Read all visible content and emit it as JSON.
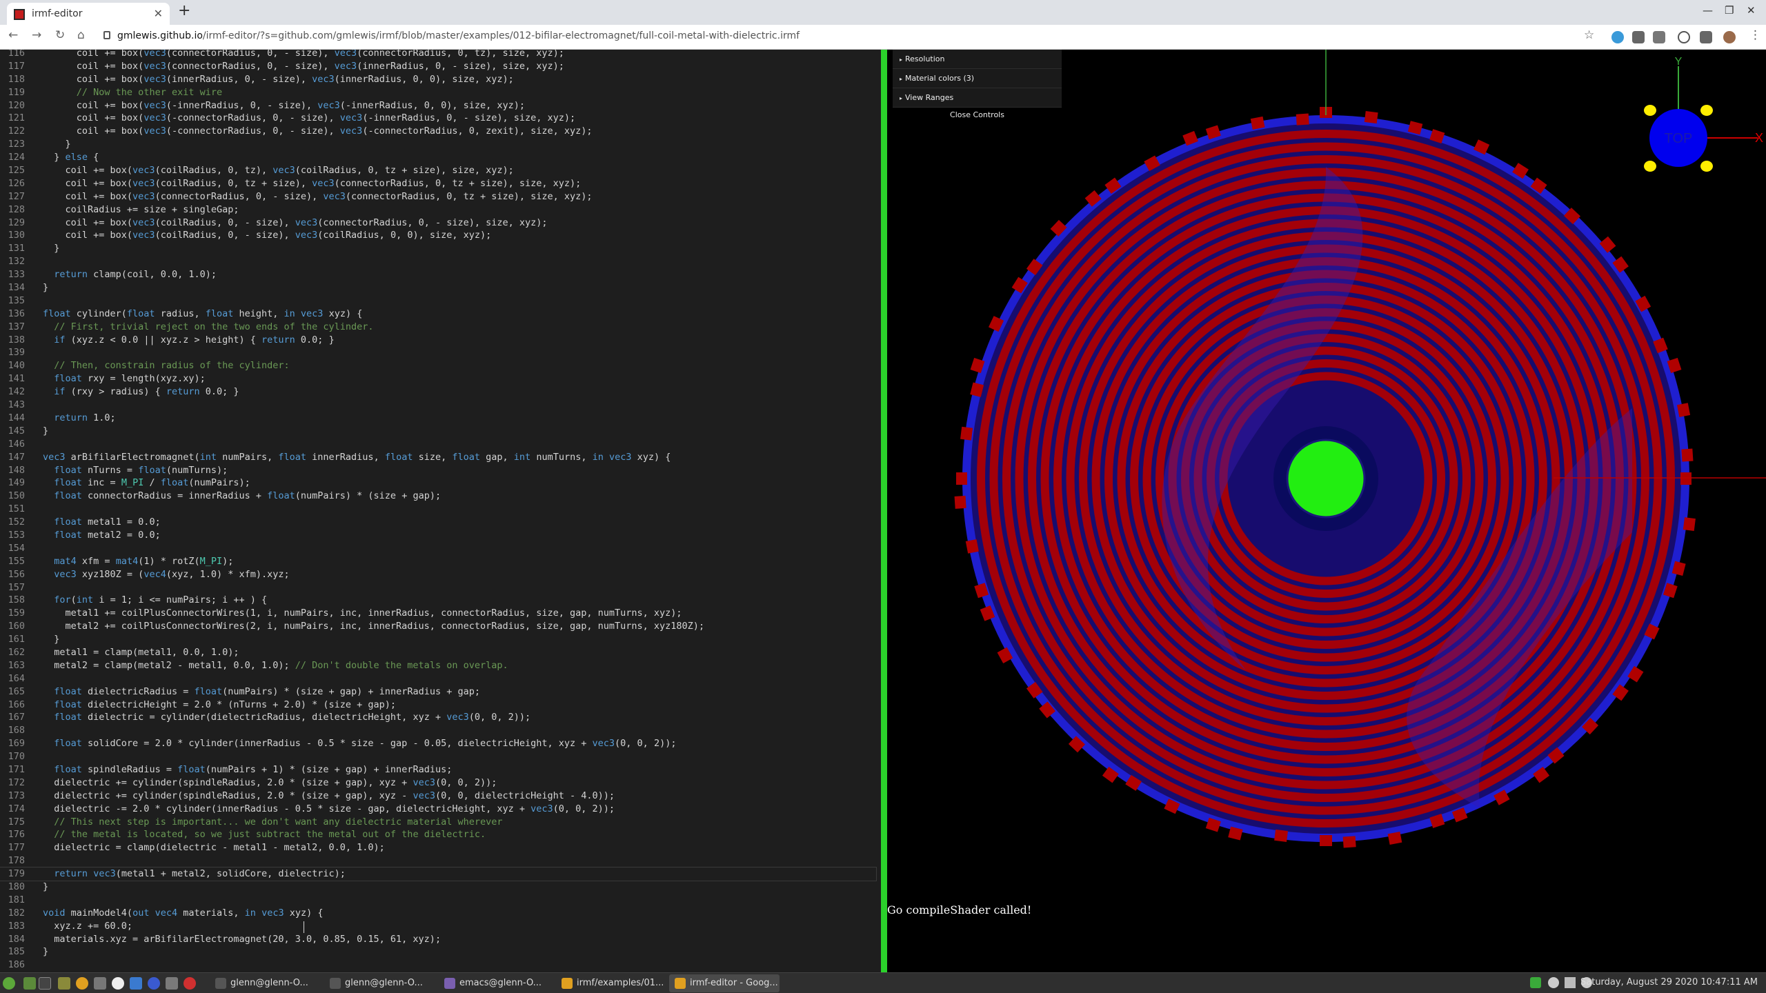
{
  "browser": {
    "tab_title": "irmf-editor",
    "tab_close": "✕",
    "new_tab": "+",
    "win_min": "—",
    "win_max": "❐",
    "win_close": "✕",
    "nav_back": "←",
    "nav_forward": "→",
    "nav_reload": "↻",
    "nav_home": "⌂",
    "url_host": "gmlewis.github.io",
    "url_path": "/irmf-editor/?s=github.com/gmlewis/irmf/blob/master/examples/012-bifilar-electromagnet/full-coil-metal-with-dielectric.irmf",
    "bookmark_star": "☆"
  },
  "editor": {
    "lines": [
      {
        "n": "116",
        "t": "      coil += box(vec3(connectorRadius, 0, - size), vec3(connectorRadius, 0, tz), size, xyz);"
      },
      {
        "n": "117",
        "t": "      coil += box(vec3(connectorRadius, 0, - size), vec3(innerRadius, 0, - size), size, xyz);"
      },
      {
        "n": "118",
        "t": "      coil += box(vec3(innerRadius, 0, - size), vec3(innerRadius, 0, 0), size, xyz);"
      },
      {
        "n": "119",
        "t": "      // Now the other exit wire"
      },
      {
        "n": "120",
        "t": "      coil += box(vec3(-innerRadius, 0, - size), vec3(-innerRadius, 0, 0), size, xyz);"
      },
      {
        "n": "121",
        "t": "      coil += box(vec3(-connectorRadius, 0, - size), vec3(-innerRadius, 0, - size), size, xyz);"
      },
      {
        "n": "122",
        "t": "      coil += box(vec3(-connectorRadius, 0, - size), vec3(-connectorRadius, 0, zexit), size, xyz);"
      },
      {
        "n": "123",
        "t": "    }"
      },
      {
        "n": "124",
        "t": "  } else {"
      },
      {
        "n": "125",
        "t": "    coil += box(vec3(coilRadius, 0, tz), vec3(coilRadius, 0, tz + size), size, xyz);"
      },
      {
        "n": "126",
        "t": "    coil += box(vec3(coilRadius, 0, tz + size), vec3(connectorRadius, 0, tz + size), size, xyz);"
      },
      {
        "n": "127",
        "t": "    coil += box(vec3(connectorRadius, 0, - size), vec3(connectorRadius, 0, tz + size), size, xyz);"
      },
      {
        "n": "128",
        "t": "    coilRadius += size + singleGap;"
      },
      {
        "n": "129",
        "t": "    coil += box(vec3(coilRadius, 0, - size), vec3(connectorRadius, 0, - size), size, xyz);"
      },
      {
        "n": "130",
        "t": "    coil += box(vec3(coilRadius, 0, - size), vec3(coilRadius, 0, 0), size, xyz);"
      },
      {
        "n": "131",
        "t": "  }"
      },
      {
        "n": "132",
        "t": ""
      },
      {
        "n": "133",
        "t": "  return clamp(coil, 0.0, 1.0);"
      },
      {
        "n": "134",
        "t": "}"
      },
      {
        "n": "135",
        "t": ""
      },
      {
        "n": "136",
        "t": "float cylinder(float radius, float height, in vec3 xyz) {"
      },
      {
        "n": "137",
        "t": "  // First, trivial reject on the two ends of the cylinder."
      },
      {
        "n": "138",
        "t": "  if (xyz.z < 0.0 || xyz.z > height) { return 0.0; }"
      },
      {
        "n": "139",
        "t": ""
      },
      {
        "n": "140",
        "t": "  // Then, constrain radius of the cylinder:"
      },
      {
        "n": "141",
        "t": "  float rxy = length(xyz.xy);"
      },
      {
        "n": "142",
        "t": "  if (rxy > radius) { return 0.0; }"
      },
      {
        "n": "143",
        "t": ""
      },
      {
        "n": "144",
        "t": "  return 1.0;"
      },
      {
        "n": "145",
        "t": "}"
      },
      {
        "n": "146",
        "t": ""
      },
      {
        "n": "147",
        "t": "vec3 arBifilarElectromagnet(int numPairs, float innerRadius, float size, float gap, int numTurns, in vec3 xyz) {"
      },
      {
        "n": "148",
        "t": "  float nTurns = float(numTurns);"
      },
      {
        "n": "149",
        "t": "  float inc = M_PI / float(numPairs);"
      },
      {
        "n": "150",
        "t": "  float connectorRadius = innerRadius + float(numPairs) * (size + gap);"
      },
      {
        "n": "151",
        "t": ""
      },
      {
        "n": "152",
        "t": "  float metal1 = 0.0;"
      },
      {
        "n": "153",
        "t": "  float metal2 = 0.0;"
      },
      {
        "n": "154",
        "t": ""
      },
      {
        "n": "155",
        "t": "  mat4 xfm = mat4(1) * rotZ(M_PI);"
      },
      {
        "n": "156",
        "t": "  vec3 xyz180Z = (vec4(xyz, 1.0) * xfm).xyz;"
      },
      {
        "n": "157",
        "t": ""
      },
      {
        "n": "158",
        "t": "  for(int i = 1; i <= numPairs; i ++ ) {"
      },
      {
        "n": "159",
        "t": "    metal1 += coilPlusConnectorWires(1, i, numPairs, inc, innerRadius, connectorRadius, size, gap, numTurns, xyz);"
      },
      {
        "n": "160",
        "t": "    metal2 += coilPlusConnectorWires(2, i, numPairs, inc, innerRadius, connectorRadius, size, gap, numTurns, xyz180Z);"
      },
      {
        "n": "161",
        "t": "  }"
      },
      {
        "n": "162",
        "t": "  metal1 = clamp(metal1, 0.0, 1.0);"
      },
      {
        "n": "163",
        "t": "  metal2 = clamp(metal2 - metal1, 0.0, 1.0); // Don't double the metals on overlap."
      },
      {
        "n": "164",
        "t": ""
      },
      {
        "n": "165",
        "t": "  float dielectricRadius = float(numPairs) * (size + gap) + innerRadius + gap;"
      },
      {
        "n": "166",
        "t": "  float dielectricHeight = 2.0 * (nTurns + 2.0) * (size + gap);"
      },
      {
        "n": "167",
        "t": "  float dielectric = cylinder(dielectricRadius, dielectricHeight, xyz + vec3(0, 0, 2));"
      },
      {
        "n": "168",
        "t": ""
      },
      {
        "n": "169",
        "t": "  float solidCore = 2.0 * cylinder(innerRadius - 0.5 * size - gap - 0.05, dielectricHeight, xyz + vec3(0, 0, 2));"
      },
      {
        "n": "170",
        "t": ""
      },
      {
        "n": "171",
        "t": "  float spindleRadius = float(numPairs + 1) * (size + gap) + innerRadius;"
      },
      {
        "n": "172",
        "t": "  dielectric += cylinder(spindleRadius, 2.0 * (size + gap), xyz + vec3(0, 0, 2));"
      },
      {
        "n": "173",
        "t": "  dielectric += cylinder(spindleRadius, 2.0 * (size + gap), xyz - vec3(0, 0, dielectricHeight - 4.0));"
      },
      {
        "n": "174",
        "t": "  dielectric -= 2.0 * cylinder(innerRadius - 0.5 * size - gap, dielectricHeight, xyz + vec3(0, 0, 2));"
      },
      {
        "n": "175",
        "t": "  // This next step is important... we don't want any dielectric material wherever"
      },
      {
        "n": "176",
        "t": "  // the metal is located, so we just subtract the metal out of the dielectric."
      },
      {
        "n": "177",
        "t": "  dielectric = clamp(dielectric - metal1 - metal2, 0.0, 1.0);"
      },
      {
        "n": "178",
        "t": ""
      },
      {
        "n": "179",
        "t": "  return vec3(metal1 + metal2, solidCore, dielectric);"
      },
      {
        "n": "180",
        "t": "}"
      },
      {
        "n": "181",
        "t": ""
      },
      {
        "n": "182",
        "t": "void mainModel4(out vec4 materials, in vec3 xyz) {"
      },
      {
        "n": "183",
        "t": "  xyz.z += 60.0;"
      },
      {
        "n": "184",
        "t": "  materials.xyz = arBifilarElectromagnet(20, 3.0, 0.85, 0.15, 61, xyz);"
      },
      {
        "n": "185",
        "t": "}"
      },
      {
        "n": "186",
        "t": ""
      }
    ]
  },
  "viewer": {
    "controls": {
      "resolution": "Resolution",
      "material_colors": "Material colors (3)",
      "view_ranges": "View Ranges",
      "close": "Close Controls"
    },
    "nav_cube": {
      "label": "TOP",
      "x_axis": "X",
      "y_axis": "Y"
    },
    "message": "Go compileShader called!",
    "colors": {
      "metal": "#b00000",
      "dielectric": "#1f1fd0",
      "core": "#22ee11",
      "background": "#000000"
    }
  },
  "taskbar": {
    "tasks": [
      {
        "label": "glenn@glenn-O...",
        "icon": "terminal-icon",
        "color": "#555"
      },
      {
        "label": "glenn@glenn-O...",
        "icon": "terminal-icon",
        "color": "#555"
      },
      {
        "label": "emacs@glenn-O...",
        "icon": "emacs-icon",
        "color": "#7a5fb0"
      },
      {
        "label": "irmf/examples/01...",
        "icon": "chrome-icon",
        "color": "#e0a020"
      },
      {
        "label": "irmf-editor - Goog...",
        "icon": "chrome-icon",
        "color": "#e0a020"
      }
    ],
    "clock": "Saturday, August 29 2020 10:47:11 AM"
  }
}
